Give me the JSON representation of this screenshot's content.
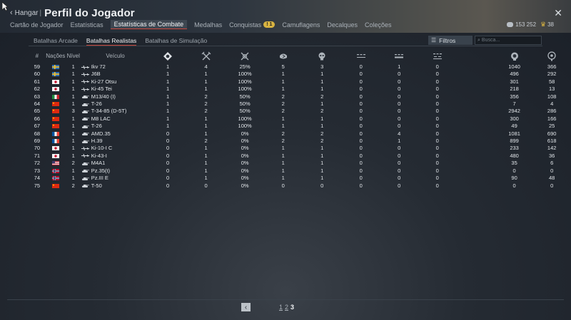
{
  "header": {
    "back_label": "Hangar",
    "separator": "|",
    "title": "Perfil do Jogador"
  },
  "tabs": [
    {
      "label": "Cartão de Jogador",
      "active": false
    },
    {
      "label": "Estatísticas",
      "active": false
    },
    {
      "label": "Estatísticas de Combate",
      "active": true
    },
    {
      "label": "Medalhas",
      "active": false
    },
    {
      "label": "Conquistas",
      "active": false,
      "badge": "1"
    },
    {
      "label": "Camuflagens",
      "active": false
    },
    {
      "label": "Decalques",
      "active": false
    },
    {
      "label": "Coleções",
      "active": false
    }
  ],
  "currency": {
    "silver": "153 252",
    "gold": "38"
  },
  "subtabs": [
    {
      "label": "Batalhas Arcade",
      "active": false
    },
    {
      "label": "Batalhas Realistas",
      "active": true
    },
    {
      "label": "Batalhas de Simulação",
      "active": false
    }
  ],
  "filters_label": "Filtros",
  "search_placeholder": "Busca...",
  "columns": {
    "num": "#",
    "nation": "Nações",
    "level": "Nível",
    "vehicle": "Veículo"
  },
  "stat_icons": [
    "victories-icon",
    "battles-icon",
    "win-rate-icon",
    "respawns-icon",
    "deaths-icon",
    "air-kills-icon",
    "ground-kills-icon",
    "naval-kills-icon",
    "activity-icon",
    "rp-icon",
    "sl-icon"
  ],
  "colors": {
    "accent": "#c7453a",
    "highlight": "#e1c046",
    "text": "#e1e5e9"
  },
  "rows": [
    {
      "n": "59",
      "nation": "sweden",
      "lvl": "1",
      "type": "plane",
      "name": "Ikv 72",
      "v": [
        "1",
        "4",
        "25%",
        "5",
        "3",
        "0",
        "1",
        "0",
        "1040",
        "366"
      ]
    },
    {
      "n": "60",
      "nation": "sweden",
      "lvl": "1",
      "type": "plane",
      "name": "J6B",
      "v": [
        "1",
        "1",
        "100%",
        "1",
        "1",
        "0",
        "0",
        "0",
        "496",
        "292"
      ]
    },
    {
      "n": "61",
      "nation": "japan",
      "lvl": "1",
      "type": "plane",
      "name": "Ki-27 Otsu",
      "v": [
        "1",
        "1",
        "100%",
        "1",
        "1",
        "0",
        "0",
        "0",
        "301",
        "58"
      ]
    },
    {
      "n": "62",
      "nation": "japan",
      "lvl": "1",
      "type": "plane",
      "name": "Ki-45 Tei",
      "v": [
        "1",
        "1",
        "100%",
        "1",
        "1",
        "0",
        "0",
        "0",
        "218",
        "13"
      ]
    },
    {
      "n": "63",
      "nation": "italy",
      "lvl": "1",
      "type": "tank",
      "name": "M13/40 (I)",
      "v": [
        "1",
        "2",
        "50%",
        "2",
        "2",
        "0",
        "0",
        "0",
        "356",
        "108"
      ]
    },
    {
      "n": "64",
      "nation": "china",
      "lvl": "1",
      "type": "tank",
      "name": "T-26",
      "v": [
        "1",
        "2",
        "50%",
        "2",
        "1",
        "0",
        "0",
        "0",
        "7",
        "4"
      ]
    },
    {
      "n": "65",
      "nation": "china",
      "lvl": "3",
      "type": "tank",
      "name": "T-34-85 (D-5T)",
      "v": [
        "1",
        "2",
        "50%",
        "2",
        "2",
        "0",
        "0",
        "0",
        "2942",
        "286"
      ]
    },
    {
      "n": "66",
      "nation": "china",
      "lvl": "1",
      "type": "tank",
      "name": "M8 LAC",
      "v": [
        "1",
        "1",
        "100%",
        "1",
        "1",
        "0",
        "0",
        "0",
        "300",
        "166"
      ]
    },
    {
      "n": "67",
      "nation": "china",
      "lvl": "1",
      "type": "tank",
      "name": "T-26",
      "v": [
        "1",
        "1",
        "100%",
        "1",
        "1",
        "0",
        "0",
        "0",
        "49",
        "25"
      ]
    },
    {
      "n": "68",
      "nation": "france",
      "lvl": "1",
      "type": "tank",
      "name": "AMD.35",
      "v": [
        "0",
        "1",
        "0%",
        "2",
        "2",
        "0",
        "4",
        "0",
        "1081",
        "690"
      ]
    },
    {
      "n": "69",
      "nation": "france",
      "lvl": "1",
      "type": "tank",
      "name": "H.39",
      "v": [
        "0",
        "2",
        "0%",
        "2",
        "2",
        "0",
        "1",
        "0",
        "899",
        "618"
      ]
    },
    {
      "n": "70",
      "nation": "japan",
      "lvl": "1",
      "type": "plane",
      "name": "Ki-10-I C",
      "v": [
        "0",
        "1",
        "0%",
        "1",
        "1",
        "0",
        "0",
        "0",
        "233",
        "142"
      ]
    },
    {
      "n": "71",
      "nation": "japan",
      "lvl": "1",
      "type": "plane",
      "name": "Ki-43-I",
      "v": [
        "0",
        "1",
        "0%",
        "1",
        "1",
        "0",
        "0",
        "0",
        "480",
        "36"
      ]
    },
    {
      "n": "72",
      "nation": "usa",
      "lvl": "2",
      "type": "tank",
      "name": "M4A1",
      "v": [
        "0",
        "1",
        "0%",
        "1",
        "1",
        "0",
        "0",
        "0",
        "35",
        "6"
      ]
    },
    {
      "n": "73",
      "nation": "norway",
      "lvl": "1",
      "type": "tank",
      "name": "Pz.35(t)",
      "v": [
        "0",
        "1",
        "0%",
        "1",
        "1",
        "0",
        "0",
        "0",
        "0",
        "0"
      ]
    },
    {
      "n": "74",
      "nation": "norway",
      "lvl": "1",
      "type": "tank",
      "name": "Pz.III E",
      "v": [
        "0",
        "1",
        "0%",
        "1",
        "1",
        "0",
        "0",
        "0",
        "90",
        "48"
      ]
    },
    {
      "n": "75",
      "nation": "china",
      "lvl": "2",
      "type": "tank",
      "name": "T-50",
      "v": [
        "0",
        "0",
        "0%",
        "0",
        "0",
        "0",
        "0",
        "0",
        "0",
        "0"
      ]
    }
  ],
  "pager": {
    "prev_icon": "chevron-left-icon",
    "pages": [
      "1",
      "2",
      "3"
    ],
    "current": "3"
  }
}
